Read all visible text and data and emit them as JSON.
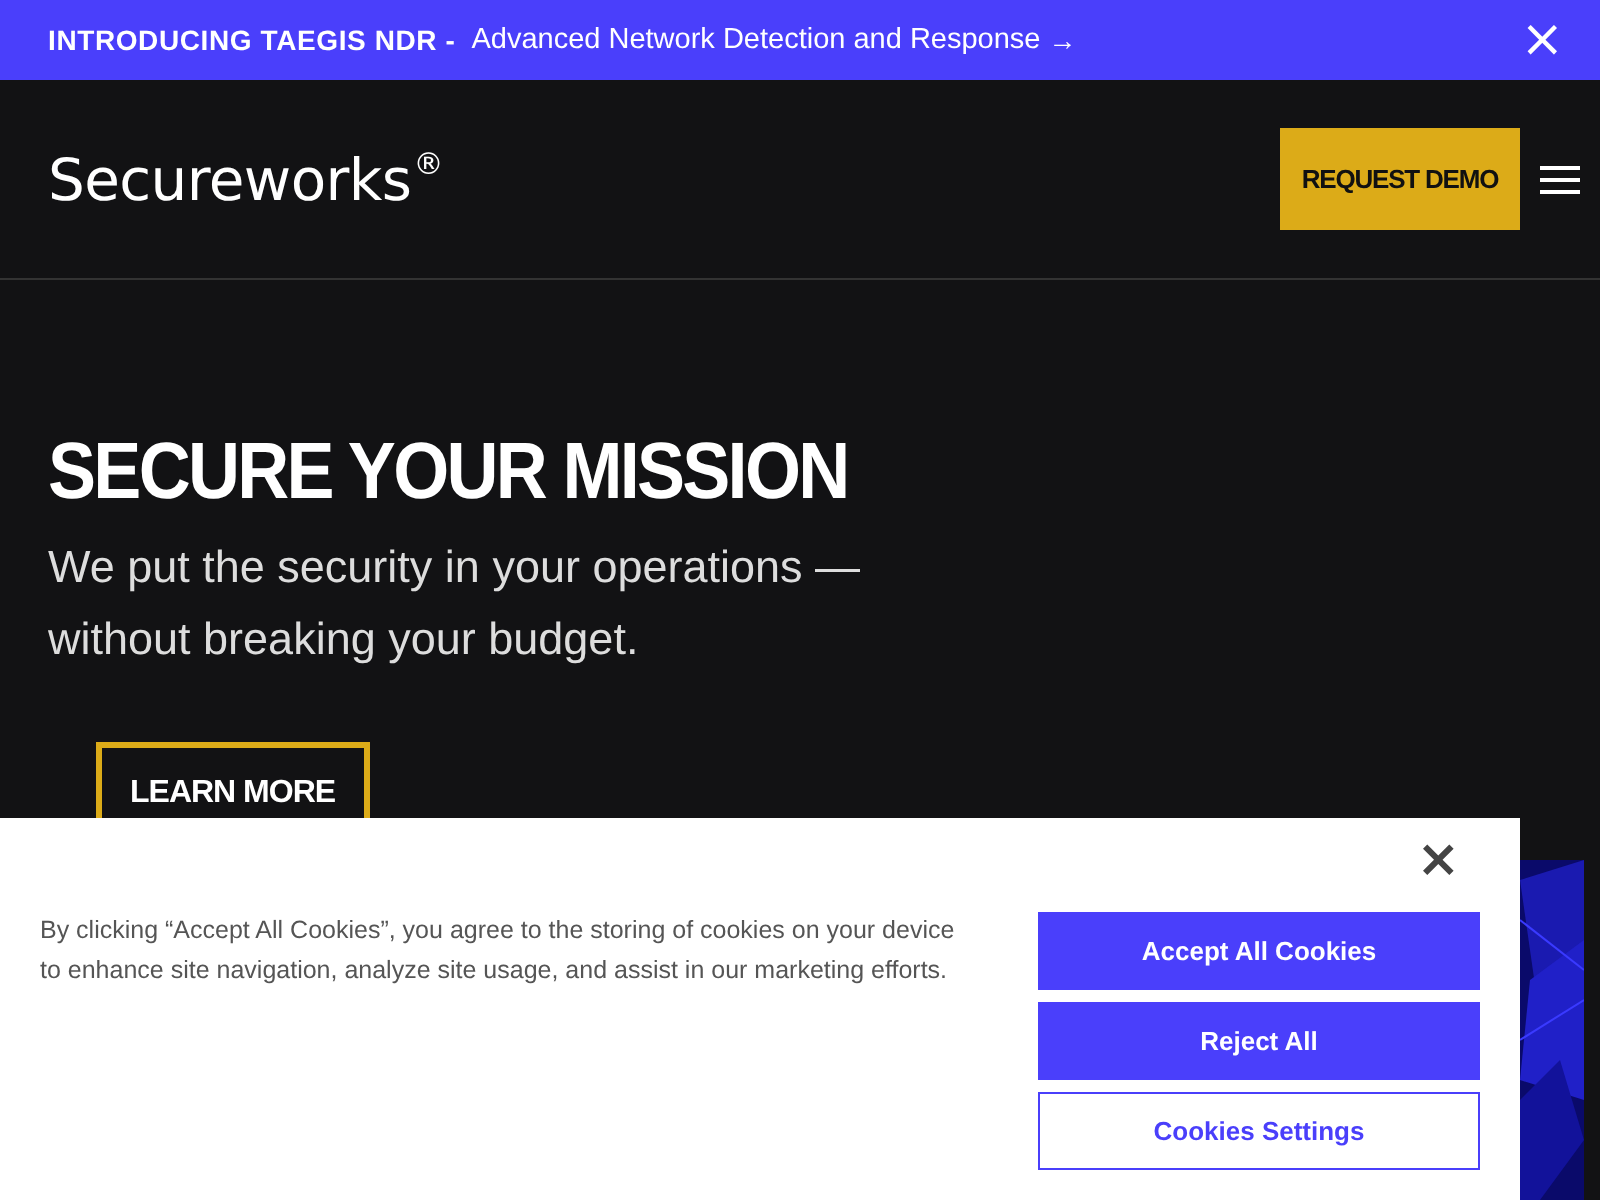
{
  "promo_bar": {
    "label": "INTRODUCING TAEGIS NDR -",
    "link": "Advanced Network Detection and Response",
    "arrow": "→",
    "close": "×"
  },
  "header": {
    "logo": "Secureworks",
    "logo_mark": "®",
    "cta": "REQUEST DEMO"
  },
  "hero": {
    "title": "SECURE YOUR MISSION",
    "subtitle": "We put the security in your operations — without breaking your budget.",
    "button": "LEARN MORE"
  },
  "cookie_banner": {
    "text": "By clicking “Accept All Cookies”, you agree to the storing of cookies on your device to enhance site navigation, analyze site usage, and assist in our marketing efforts.",
    "close": "×",
    "buttons": [
      {
        "label": "Accept All Cookies",
        "kind": "primary"
      },
      {
        "label": "Reject All",
        "kind": "primary"
      },
      {
        "label": "Cookies Settings",
        "kind": "outline"
      }
    ]
  }
}
